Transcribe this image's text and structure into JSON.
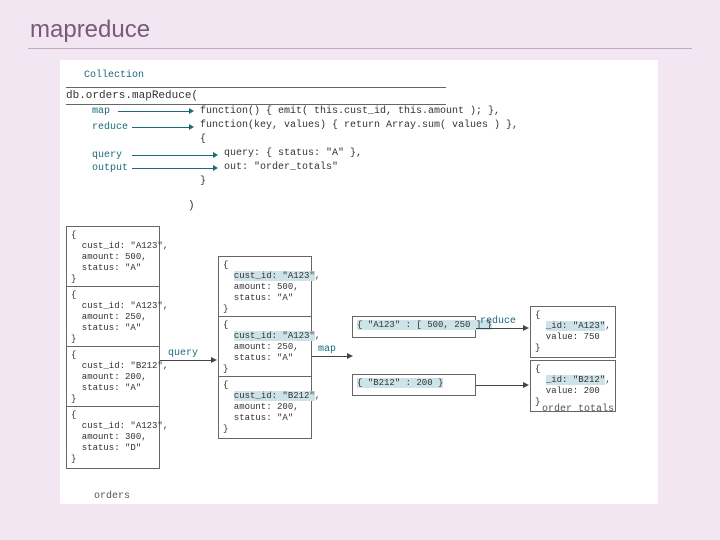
{
  "title": "mapreduce",
  "collection_label": "Collection",
  "invoke": "db.orders.mapReduce(",
  "code_tags": {
    "map": "map",
    "reduce": "reduce",
    "query": "query",
    "output": "output"
  },
  "fn_map": "function() { emit( this.cust_id, this.amount ); },",
  "fn_reduce": "function(key, values) { return Array.sum( values ) },",
  "opts_open": "{",
  "opts_query": "    query: { status: \"A\" },",
  "opts_out": "    out: \"order_totals\"",
  "opts_close": "}",
  "close_paren": ")",
  "orders_caption": "orders",
  "output_caption": "order_totals",
  "orders": [
    {
      "cust_id": "\"A123\"",
      "amount": "500",
      "status": "\"A\""
    },
    {
      "cust_id": "\"A123\"",
      "amount": "250",
      "status": "\"A\""
    },
    {
      "cust_id": "\"B212\"",
      "amount": "200",
      "status": "\"A\""
    },
    {
      "cust_id": "\"A123\"",
      "amount": "300",
      "status": "\"D\""
    }
  ],
  "filtered": [
    {
      "cust_id": "\"A123\"",
      "amount": "500",
      "status": "\"A\""
    },
    {
      "cust_id": "\"A123\"",
      "amount": "250",
      "status": "\"A\""
    },
    {
      "cust_id": "\"B212\"",
      "amount": "200",
      "status": "\"A\""
    }
  ],
  "pairs": [
    {
      "text": "{ \"A123\" : [ 500, 250 ] }"
    },
    {
      "text": "{ \"B212\" : 200 }"
    }
  ],
  "results": [
    {
      "id": "\"A123\"",
      "value": "750"
    },
    {
      "id": "\"B212\"",
      "value": "200"
    }
  ],
  "flow_labels": {
    "query": "query",
    "map": "map",
    "reduce": "reduce"
  }
}
